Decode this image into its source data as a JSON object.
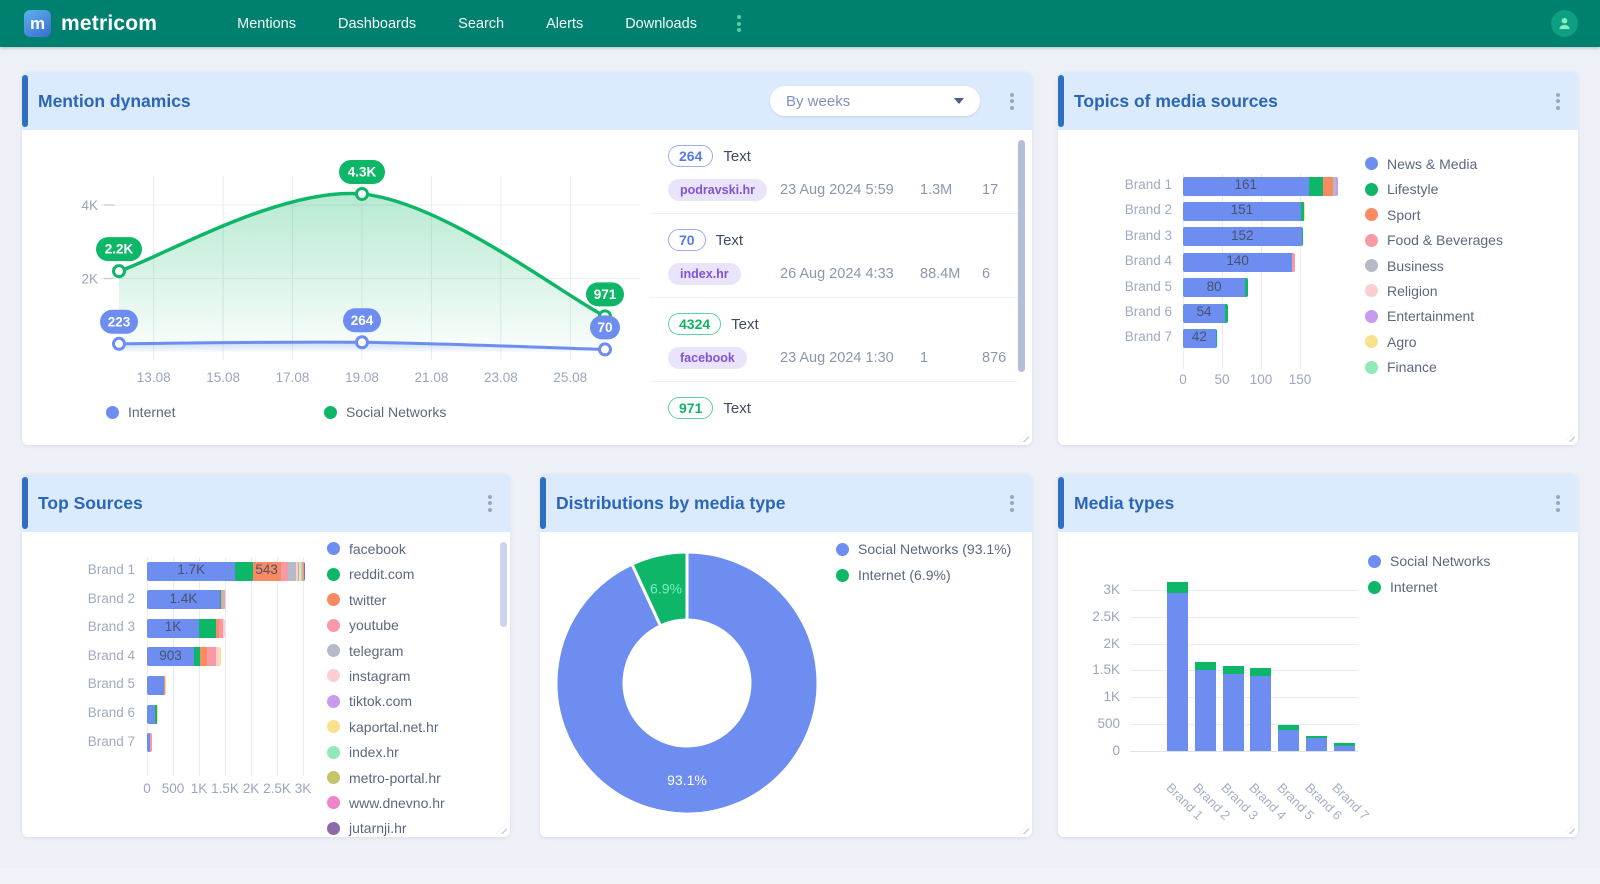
{
  "nav": {
    "logo_letter": "m",
    "brand": "metricom",
    "items": [
      "Mentions",
      "Dashboards",
      "Search",
      "Alerts",
      "Downloads"
    ]
  },
  "cards": {
    "mention_dynamics": {
      "title": "Mention dynamics",
      "period_selector": "By weeks",
      "list": [
        {
          "count": "264",
          "count_color": "blue",
          "type": "Text",
          "source": "podravski.hr",
          "datetime": "23 Aug 2024 5:59",
          "reach": "1.3M",
          "engagement": "17"
        },
        {
          "count": "70",
          "count_color": "blue",
          "type": "Text",
          "source": "index.hr",
          "datetime": "26 Aug 2024 4:33",
          "reach": "88.4M",
          "engagement": "6"
        },
        {
          "count": "4324",
          "count_color": "green",
          "type": "Text",
          "source": "facebook",
          "datetime": "23 Aug 2024 1:30",
          "reach": "1",
          "engagement": "876"
        },
        {
          "count": "971",
          "count_color": "green",
          "type": "Text"
        }
      ]
    },
    "topics": {
      "title": "Topics of media sources"
    },
    "top_sources": {
      "title": "Top Sources"
    },
    "distribution": {
      "title": "Distributions by media type"
    },
    "media_types": {
      "title": "Media types"
    }
  },
  "colors": {
    "nav_bg": "#008170",
    "header_bg": "#dbeafd",
    "header_stripe": "#2e6fc0",
    "title_blue": "#2a66b8",
    "series_blue": "#6d8df0",
    "series_green": "#0eb768"
  },
  "chart_data": [
    {
      "id": "mention_dynamics",
      "type": "line",
      "title": "Mention dynamics",
      "x_ticks": [
        {
          "label": "13.08",
          "f": 0.0714
        },
        {
          "label": "15.08",
          "f": 0.2143
        },
        {
          "label": "17.08",
          "f": 0.3571
        },
        {
          "label": "19.08",
          "f": 0.5
        },
        {
          "label": "21.08",
          "f": 0.6429
        },
        {
          "label": "23.08",
          "f": 0.7857
        },
        {
          "label": "25.08",
          "f": 0.9286
        }
      ],
      "y_ticks": [
        {
          "label": "2K",
          "v": 2000
        },
        {
          "label": "4K",
          "v": 4000
        }
      ],
      "ylim": [
        0,
        4300
      ],
      "series": [
        {
          "name": "Social Networks",
          "color": "#0eb768",
          "area": true,
          "points": [
            {
              "f": 0,
              "v": 2200,
              "label": "2.2K"
            },
            {
              "f": 0.5,
              "v": 4300,
              "label": "4.3K"
            },
            {
              "f": 1,
              "v": 971,
              "label": "971"
            }
          ]
        },
        {
          "name": "Internet",
          "color": "#6d8df0",
          "area": true,
          "points": [
            {
              "f": 0,
              "v": 223,
              "label": "223"
            },
            {
              "f": 0.5,
              "v": 264,
              "label": "264"
            },
            {
              "f": 1,
              "v": 70,
              "label": "70"
            }
          ]
        }
      ],
      "legend": [
        {
          "label": "Internet",
          "color": "#6d8df0"
        },
        {
          "label": "Social Networks",
          "color": "#0eb768"
        }
      ]
    },
    {
      "id": "topics",
      "type": "stacked_bar_h",
      "title": "Topics of media sources",
      "categories": [
        "Brand 1",
        "Brand 2",
        "Brand 3",
        "Brand 4",
        "Brand 5",
        "Brand 6",
        "Brand 7"
      ],
      "x_ticks": [
        {
          "label": "0",
          "v": 0
        },
        {
          "label": "50",
          "v": 50
        },
        {
          "label": "100",
          "v": 100
        },
        {
          "label": "150",
          "v": 150
        }
      ],
      "xlim": [
        0,
        200
      ],
      "legend": [
        {
          "label": "News & Media",
          "color": "#6d8df0"
        },
        {
          "label": "Lifestyle",
          "color": "#0eb768"
        },
        {
          "label": "Sport",
          "color": "#fa8a62"
        },
        {
          "label": "Food & Beverages",
          "color": "#f79aa6"
        },
        {
          "label": "Business",
          "color": "#b4bac8"
        },
        {
          "label": "Religion",
          "color": "#fbcfd0"
        },
        {
          "label": "Entertainment",
          "color": "#c79ced"
        },
        {
          "label": "Agro",
          "color": "#f7e08e"
        },
        {
          "label": "Finance",
          "color": "#90e9b6"
        }
      ],
      "bars": [
        {
          "labels": [
            {
              "seg": 0,
              "text": "161"
            }
          ],
          "segments": [
            [
              "News & Media",
              161
            ],
            [
              "Lifestyle",
              18
            ],
            [
              "Sport",
              13
            ],
            [
              "Business",
              4
            ],
            [
              "Entertainment",
              3
            ]
          ]
        },
        {
          "labels": [
            {
              "seg": 0,
              "text": "151"
            }
          ],
          "segments": [
            [
              "News & Media",
              151
            ],
            [
              "Lifestyle",
              4
            ],
            [
              "Agro",
              1
            ]
          ]
        },
        {
          "labels": [
            {
              "seg": 0,
              "text": "152"
            }
          ],
          "segments": [
            [
              "News & Media",
              152
            ],
            [
              "Lifestyle",
              2
            ]
          ]
        },
        {
          "labels": [
            {
              "seg": 0,
              "text": "140"
            }
          ],
          "segments": [
            [
              "News & Media",
              140
            ],
            [
              "Food & Beverages",
              3
            ]
          ]
        },
        {
          "labels": [
            {
              "seg": 0,
              "text": "80"
            }
          ],
          "segments": [
            [
              "News & Media",
              80
            ],
            [
              "Lifestyle",
              3
            ]
          ]
        },
        {
          "labels": [
            {
              "seg": 0,
              "text": "54"
            }
          ],
          "segments": [
            [
              "News & Media",
              54
            ],
            [
              "Lifestyle",
              4
            ]
          ]
        },
        {
          "labels": [
            {
              "seg": 0,
              "text": "42"
            }
          ],
          "segments": [
            [
              "News & Media",
              42
            ],
            [
              "Lifestyle",
              2
            ]
          ]
        }
      ]
    },
    {
      "id": "top_sources",
      "type": "stacked_bar_h",
      "title": "Top Sources",
      "categories": [
        "Brand 1",
        "Brand 2",
        "Brand 3",
        "Brand 4",
        "Brand 5",
        "Brand 6",
        "Brand 7"
      ],
      "x_ticks": [
        {
          "label": "0",
          "v": 0
        },
        {
          "label": "500",
          "v": 500
        },
        {
          "label": "1K",
          "v": 1000
        },
        {
          "label": "1.5K",
          "v": 1500
        },
        {
          "label": "2K",
          "v": 2000
        },
        {
          "label": "2.5K",
          "v": 2500
        },
        {
          "label": "3K",
          "v": 3000
        }
      ],
      "xlim": [
        0,
        3100
      ],
      "legend": [
        {
          "label": "facebook",
          "color": "#6d8df0"
        },
        {
          "label": "reddit.com",
          "color": "#0eb768"
        },
        {
          "label": "twitter",
          "color": "#fa8a62"
        },
        {
          "label": "youtube",
          "color": "#f79aa6"
        },
        {
          "label": "telegram",
          "color": "#b4bac8"
        },
        {
          "label": "instagram",
          "color": "#fbcfd0"
        },
        {
          "label": "tiktok.com",
          "color": "#c79ced"
        },
        {
          "label": "kaportal.net.hr",
          "color": "#f7e08e"
        },
        {
          "label": "index.hr",
          "color": "#90e9b6"
        },
        {
          "label": "metro-portal.hr",
          "color": "#c5c468"
        },
        {
          "label": "www.dnevno.hr",
          "color": "#ee85c8"
        },
        {
          "label": "jutarnji.hr",
          "color": "#8d6bab"
        }
      ],
      "bars": [
        {
          "labels": [
            {
              "seg": 0,
              "text": "1.7K"
            },
            {
              "seg": 2,
              "text": "543"
            }
          ],
          "segments": [
            [
              "facebook",
              1700
            ],
            [
              "reddit.com",
              330
            ],
            [
              "twitter",
              543
            ],
            [
              "youtube",
              140
            ],
            [
              "telegram",
              150
            ],
            [
              "instagram",
              40
            ],
            [
              "tiktok.com",
              30
            ],
            [
              "kaportal.net.hr",
              25
            ],
            [
              "index.hr",
              20
            ],
            [
              "metro-portal.hr",
              20
            ],
            [
              "www.dnevno.hr",
              20
            ],
            [
              "jutarnji.hr",
              20
            ]
          ]
        },
        {
          "labels": [
            {
              "seg": 0,
              "text": "1.4K"
            }
          ],
          "segments": [
            [
              "facebook",
              1400
            ],
            [
              "reddit.com",
              25
            ],
            [
              "youtube",
              45
            ],
            [
              "telegram",
              35
            ],
            [
              "instagram",
              15
            ]
          ]
        },
        {
          "labels": [
            {
              "seg": 0,
              "text": "1K"
            }
          ],
          "segments": [
            [
              "facebook",
              1000
            ],
            [
              "reddit.com",
              320
            ],
            [
              "twitter",
              60
            ],
            [
              "youtube",
              80
            ],
            [
              "instagram",
              50
            ]
          ]
        },
        {
          "labels": [
            {
              "seg": 0,
              "text": "903"
            }
          ],
          "segments": [
            [
              "facebook",
              903
            ],
            [
              "reddit.com",
              120
            ],
            [
              "twitter",
              140
            ],
            [
              "youtube",
              160
            ],
            [
              "instagram",
              70
            ],
            [
              "kaportal.net.hr",
              35
            ]
          ]
        },
        {
          "labels": [],
          "segments": [
            [
              "facebook",
              330
            ],
            [
              "twitter",
              20
            ],
            [
              "kaportal.net.hr",
              15
            ]
          ]
        },
        {
          "labels": [],
          "segments": [
            [
              "facebook",
              150
            ],
            [
              "reddit.com",
              40
            ],
            [
              "kaportal.net.hr",
              30
            ]
          ]
        },
        {
          "labels": [],
          "segments": [
            [
              "facebook",
              60
            ],
            [
              "youtube",
              35
            ]
          ]
        }
      ]
    },
    {
      "id": "distribution",
      "type": "pie",
      "title": "Distributions by media type",
      "slices": [
        {
          "name": "Social Networks",
          "pct": 93.1,
          "color": "#6d8df0",
          "label": "93.1%"
        },
        {
          "name": "Internet",
          "pct": 6.9,
          "color": "#0eb768",
          "label": "6.9%"
        }
      ],
      "legend": [
        {
          "label": "Social Networks (93.1%)",
          "color": "#6d8df0"
        },
        {
          "label": "Internet (6.9%)",
          "color": "#0eb768"
        }
      ]
    },
    {
      "id": "media_types",
      "type": "stacked_bar_v",
      "title": "Media types",
      "categories": [
        "Brand 1",
        "Brand 2",
        "Brand 3",
        "Brand 4",
        "Brand 5",
        "Brand 6",
        "Brand 7"
      ],
      "y_ticks": [
        {
          "label": "0",
          "v": 0
        },
        {
          "label": "500",
          "v": 500
        },
        {
          "label": "1K",
          "v": 1000
        },
        {
          "label": "1.5K",
          "v": 1500
        },
        {
          "label": "2K",
          "v": 2000
        },
        {
          "label": "2.5K",
          "v": 2500
        },
        {
          "label": "3K",
          "v": 3000
        }
      ],
      "ylim": [
        0,
        3300
      ],
      "series": [
        {
          "name": "Social Networks",
          "color": "#6d8df0",
          "values": [
            2950,
            1500,
            1430,
            1400,
            400,
            240,
            90
          ]
        },
        {
          "name": "Internet",
          "color": "#0eb768",
          "values": [
            200,
            150,
            160,
            140,
            80,
            40,
            55
          ]
        }
      ],
      "legend": [
        {
          "label": "Social Networks",
          "color": "#6d8df0"
        },
        {
          "label": "Internet",
          "color": "#0eb768"
        }
      ]
    }
  ]
}
